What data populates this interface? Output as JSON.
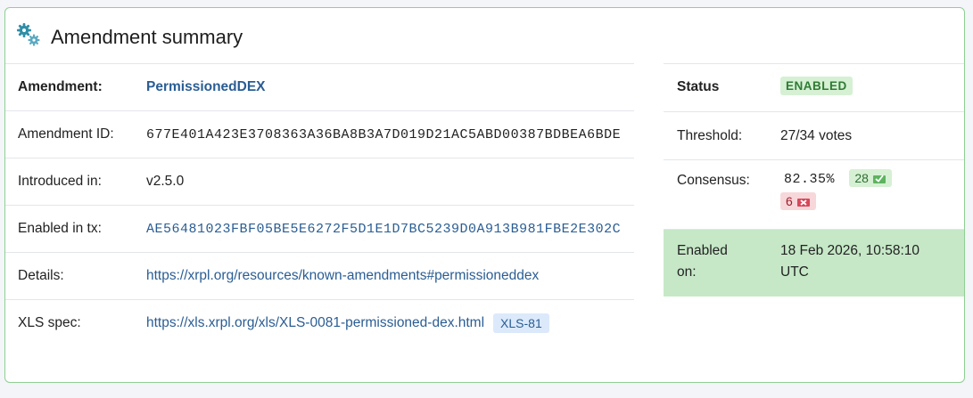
{
  "header": {
    "title": "Amendment summary",
    "icon": "gears-icon"
  },
  "left": {
    "rows": [
      {
        "label": "Amendment:",
        "value": "PermissionedDEX"
      },
      {
        "label": "Amendment ID:",
        "value": "677E401A423E3708363A36BA8B3A7D019D21AC5ABD00387BDBEA6BDE"
      },
      {
        "label": "Introduced in:",
        "value": "v2.5.0"
      },
      {
        "label": "Enabled in tx:",
        "value": "AE56481023FBF05BE5E6272F5D1E1D7BC5239D0A913B981FBE2E302C"
      },
      {
        "label": "Details:",
        "value": "https://xrpl.org/resources/known-amendments#permissioneddex"
      },
      {
        "label": "XLS spec:",
        "value": "https://xls.xrpl.org/xls/XLS-0081-permissioned-dex.html",
        "tag": "XLS-81"
      }
    ]
  },
  "right": {
    "status_label": "Status",
    "status_value": "ENABLED",
    "threshold_label": "Threshold:",
    "threshold_value": "27/34 votes",
    "consensus_label": "Consensus:",
    "consensus_value": "82.35%",
    "yes_votes": "28",
    "no_votes": "6",
    "enabled_on_label": "Enabled on:",
    "enabled_on_value": "18 Feb 2026, 10:58:10 UTC"
  },
  "colors": {
    "accent_green": "#2f7a33",
    "link": "#2a5d93",
    "enabled_bg": "#c6e8c7"
  }
}
